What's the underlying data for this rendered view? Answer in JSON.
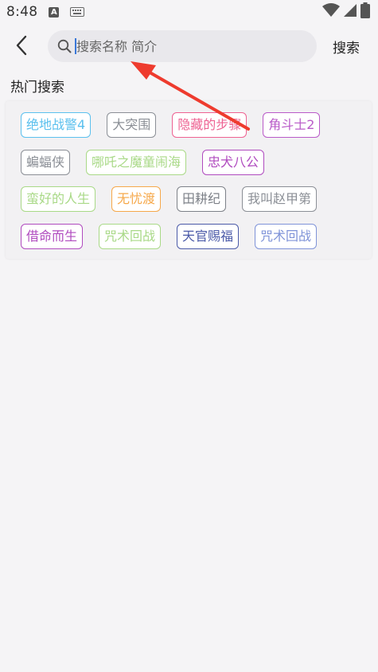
{
  "status_bar": {
    "time": "8:48",
    "icons": [
      "ime-a-icon",
      "keyboard-icon",
      "wifi-icon",
      "signal-icon",
      "battery-icon"
    ]
  },
  "header": {
    "back_icon": "chevron-left-icon",
    "search": {
      "placeholder": "搜索名称 简介",
      "value": ""
    },
    "search_button_label": "搜索"
  },
  "hot_search": {
    "title": "热门搜索",
    "rows": [
      [
        {
          "label": "绝地战警4",
          "color": "#5bc0ee"
        },
        {
          "label": "大突围",
          "color": "#8b8f96"
        },
        {
          "label": "隐藏的步骤",
          "color": "#ee6292"
        },
        {
          "label": "角斗士2",
          "color": "#b95ac8"
        }
      ],
      [
        {
          "label": "蝙蝠侠",
          "color": "#8b8f96"
        },
        {
          "label": "哪吒之魔童闹海",
          "color": "#a9d987"
        },
        {
          "label": "忠犬八公",
          "color": "#b04bbf"
        }
      ],
      [
        {
          "label": "蛮好的人生",
          "color": "#a9d987"
        },
        {
          "label": "无忧渡",
          "color": "#f6a84a"
        },
        {
          "label": "田耕纪",
          "color": "#7d8188"
        },
        {
          "label": "我叫赵甲第",
          "color": "#8b8f96"
        }
      ],
      [
        {
          "label": "借命而生",
          "color": "#b04bbf"
        },
        {
          "label": "咒术回战",
          "color": "#a9d987"
        },
        {
          "label": "天官赐福",
          "color": "#4b5aa8"
        },
        {
          "label": "咒术回战",
          "color": "#7f93d8"
        }
      ]
    ]
  },
  "annotation": {
    "arrow_color": "#ee3b2e"
  }
}
